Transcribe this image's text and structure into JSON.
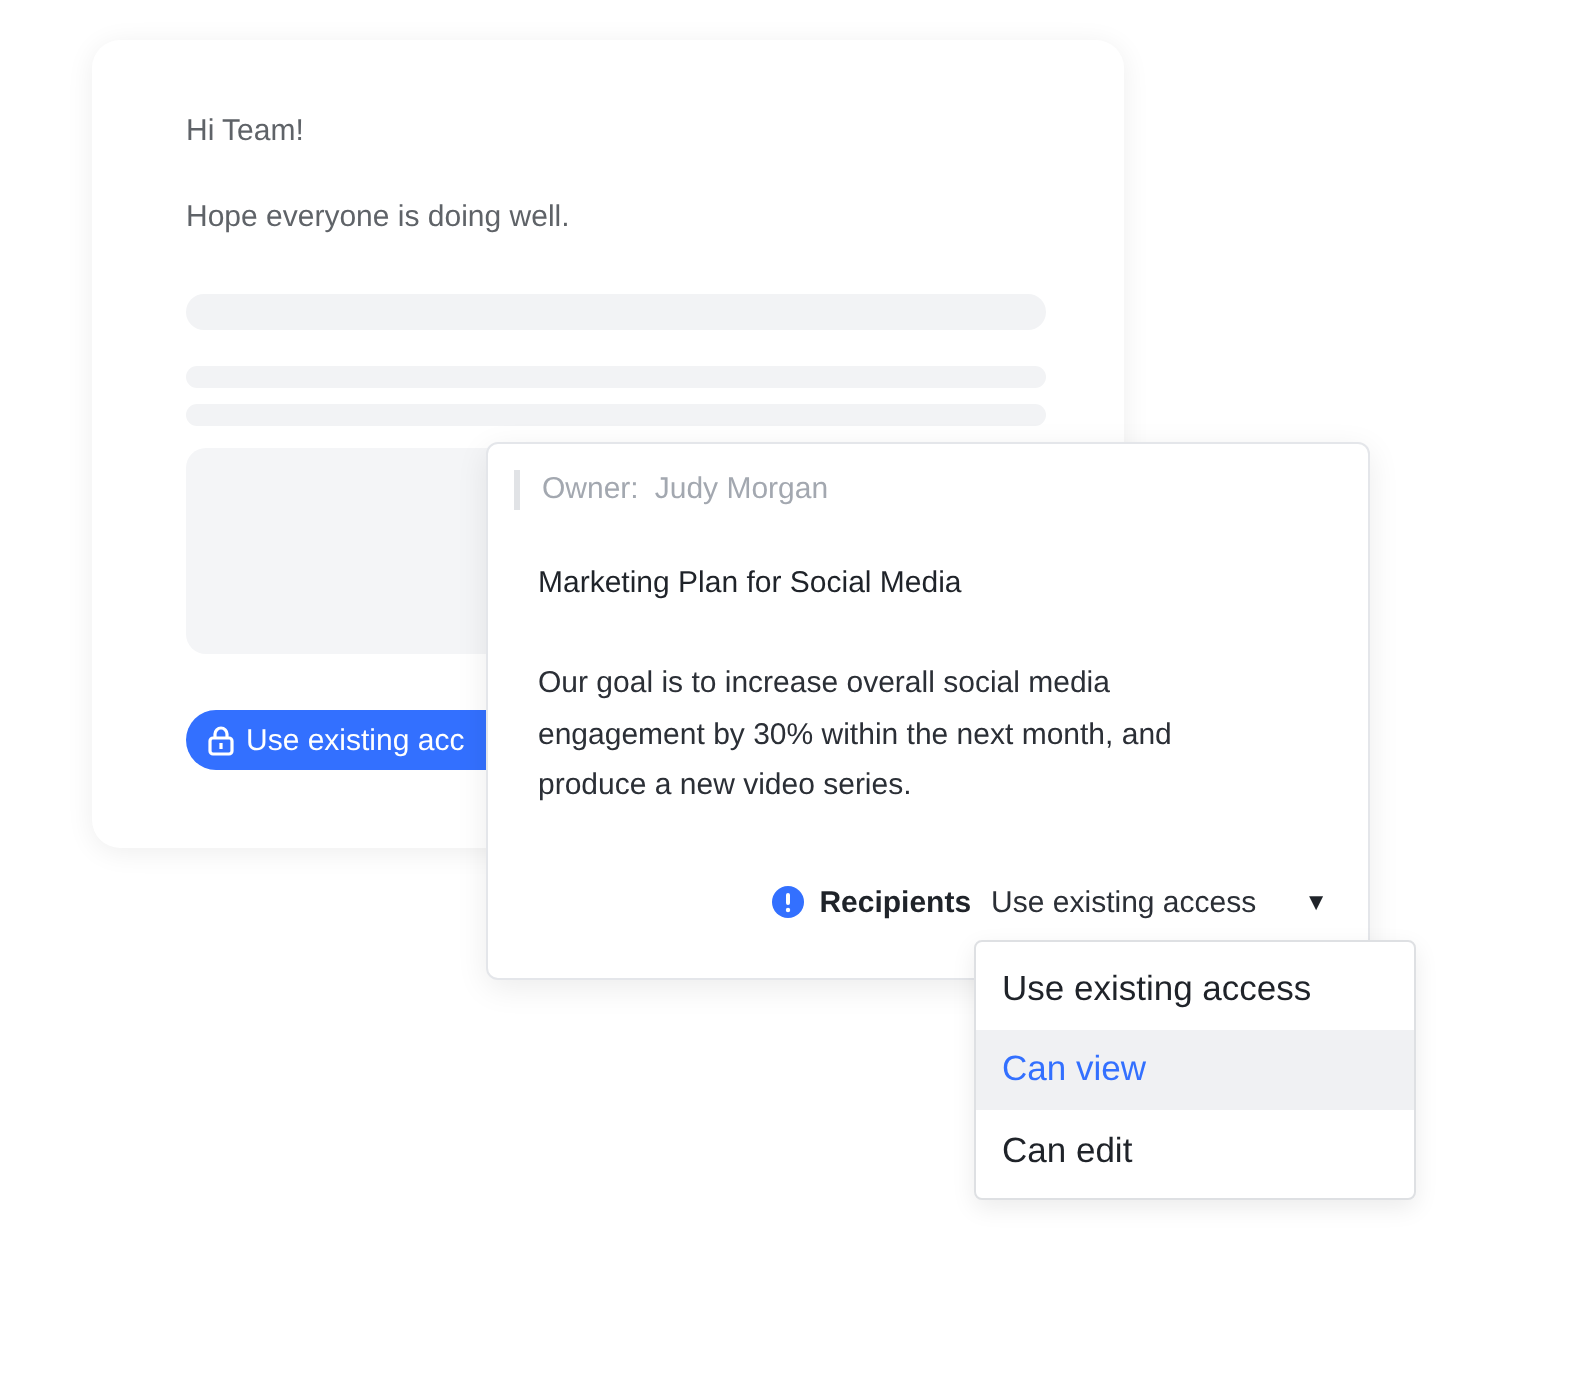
{
  "email_card": {
    "greeting": "Hi Team!",
    "line": "Hope everyone is doing well.",
    "access_pill": {
      "label": "Use existing acc"
    }
  },
  "popover": {
    "owner_label": "Owner:",
    "owner_name": "Judy Morgan",
    "title": "Marketing Plan for Social Media",
    "body": "Our goal is to increase overall social media engagement by 30% within the next month, and produce a new video series.",
    "recipients_label": "Recipients",
    "recipients_value": "Use existing access",
    "caret": "▼"
  },
  "menu": [
    {
      "label": "Use existing access",
      "selected": false
    },
    {
      "label": "Can view",
      "selected": true
    },
    {
      "label": "Can edit",
      "selected": false
    }
  ]
}
